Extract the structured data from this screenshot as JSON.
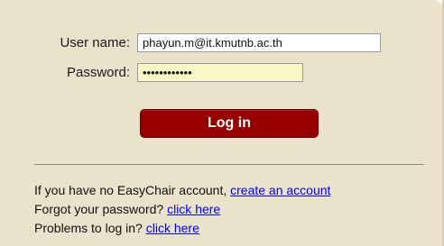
{
  "login": {
    "username_label": "User name:",
    "username_value": "phayun.m@it.kmutnb.ac.th",
    "password_label": "Password:",
    "password_value": "••••••••••••",
    "login_button": "Log in"
  },
  "footer": {
    "no_account_text": "If you have no EasyChair account, ",
    "create_account_link": "create an account",
    "forgot_text": "Forgot your password? ",
    "forgot_link": "click here",
    "problems_text": "Problems to log in? ",
    "problems_link": "click here"
  },
  "colors": {
    "panel_background": "#ebe2cc",
    "button_background": "#960000",
    "password_field_background": "#f7f8c6",
    "link": "#0000ee"
  }
}
